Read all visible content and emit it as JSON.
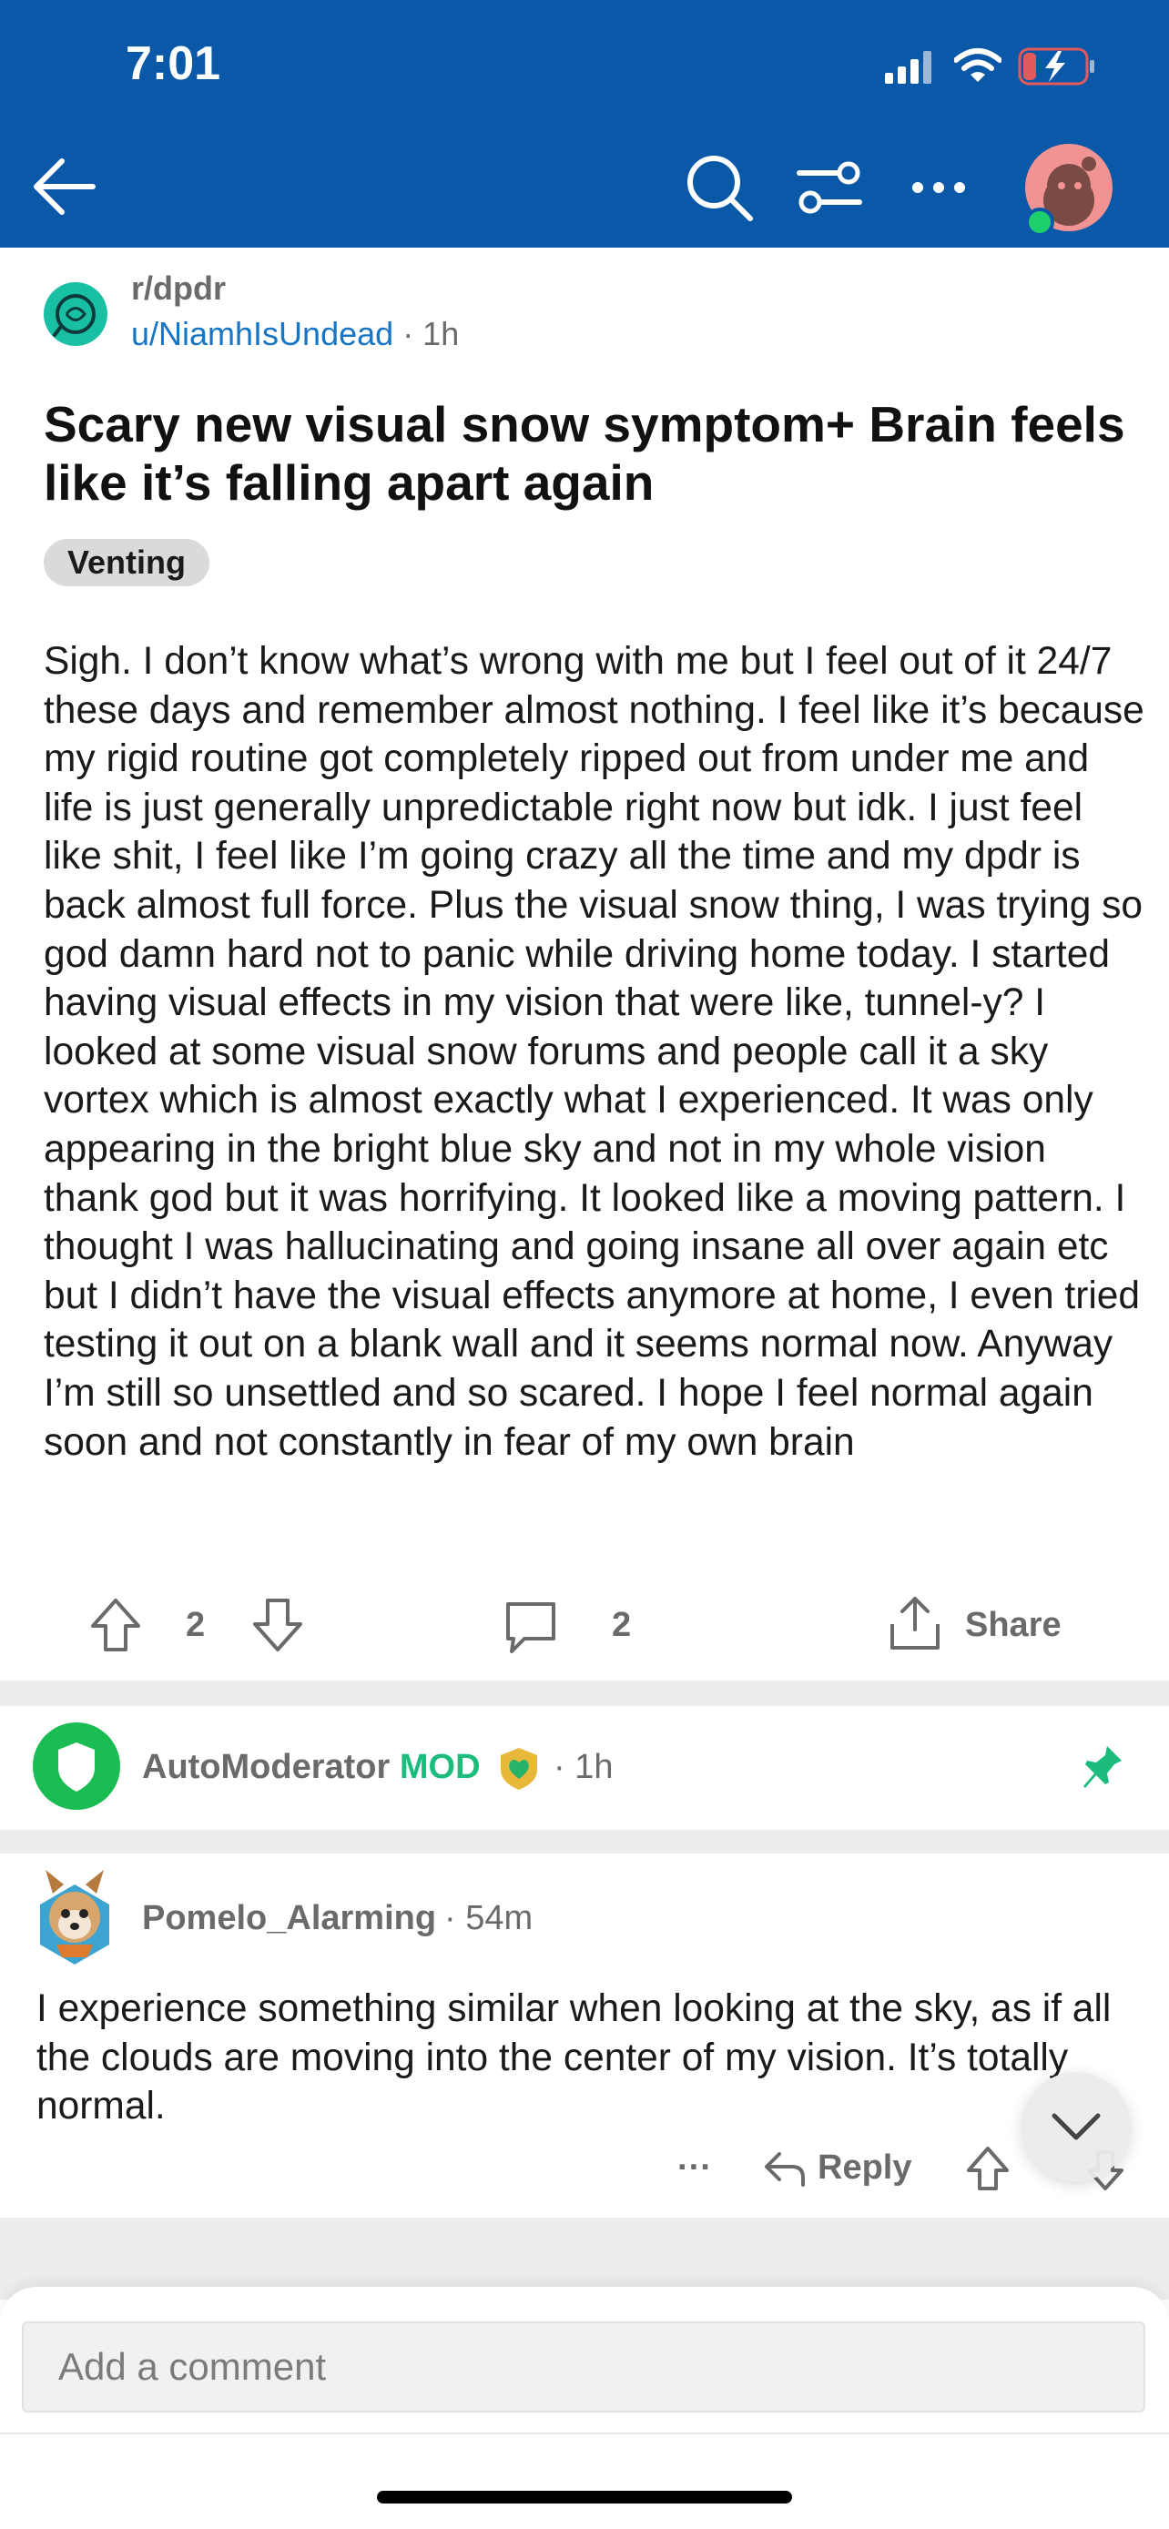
{
  "status_bar": {
    "time": "7:01"
  },
  "post": {
    "subreddit": "r/dpdr",
    "author": "u/NiamhIsUndead",
    "age": "· 1h",
    "title": "Scary new visual snow symptom+ Brain feels like it’s falling apart again",
    "flair": "Venting",
    "body": "Sigh. I don’t know what’s wrong with me but I feel out of it 24/7 these days and remember almost nothing. I feel like it’s because my rigid routine got completely ripped out from under me and life is just generally unpredictable right now but idk. I just feel like shit, I feel like I’m going crazy all the time and my dpdr is back almost full force. Plus the visual snow thing, I was trying so god damn hard not to panic while driving home today. I started having visual effects in my vision that were like, tunnel-y? I looked at some visual snow forums and people call it a sky vortex which is almost exactly what I experienced. It was only appearing in the bright blue sky and not in my whole vision thank god but it was horrifying. It looked like a moving pattern. I thought I was hallucinating and going insane all over again etc but I didn’t have the visual effects anymore at home, I even tried testing it out on a blank wall and it seems normal now. Anyway I’m still so unsettled and so scared. I hope I feel normal again soon and not constantly in fear of my own brain",
    "votes": "2",
    "comments": "2",
    "share_label": "Share"
  },
  "automod": {
    "username": "AutoModerator",
    "mod_label": "MOD",
    "age": "· 1h"
  },
  "comment": {
    "username": "Pomelo_Alarming",
    "age": "· 54m",
    "text": "I experience something similar when looking at the sky, as if all the clouds are moving into the center of my vision. It’s totally normal.",
    "more_label": "···",
    "reply_label": "Reply"
  },
  "composer": {
    "placeholder": "Add a comment"
  },
  "colors": {
    "header": "#0a58a8",
    "accent_green": "#1bbc7c",
    "link_blue": "#1675c5"
  }
}
